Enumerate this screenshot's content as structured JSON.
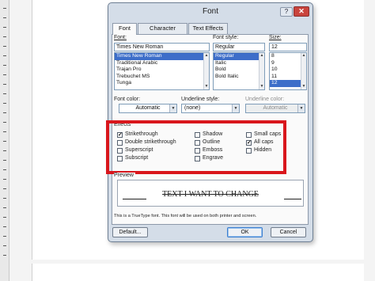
{
  "dialog": {
    "title": "Font",
    "help": "?",
    "close": "✕",
    "tabs": [
      "Font",
      "Character Spacing",
      "Text Effects"
    ]
  },
  "font_tab": {
    "font_label": "Font:",
    "font_value": "Times New Roman",
    "font_list": [
      "Times New Roman",
      "Traditional Arabic",
      "Trajan Pro",
      "Trebuchet MS",
      "Tunga"
    ],
    "font_selected": "Times New Roman",
    "style_label": "Font style:",
    "style_value": "Regular",
    "style_list": [
      "Regular",
      "Italic",
      "Bold",
      "Bold Italic"
    ],
    "style_selected": "Regular",
    "size_label": "Size:",
    "size_value": "12",
    "size_list": [
      "8",
      "9",
      "10",
      "11",
      "12"
    ],
    "size_selected": "12",
    "font_color_label": "Font color:",
    "font_color_value": "Automatic",
    "underline_style_label": "Underline style:",
    "underline_style_value": "(none)",
    "underline_color_label": "Underline color:",
    "underline_color_value": "Automatic"
  },
  "effects": {
    "label": "Effects",
    "items": [
      {
        "label": "Strikethrough",
        "checked": true
      },
      {
        "label": "Double strikethrough",
        "checked": false
      },
      {
        "label": "Superscript",
        "checked": false
      },
      {
        "label": "Subscript",
        "checked": false
      },
      {
        "label": "Shadow",
        "checked": false
      },
      {
        "label": "Outline",
        "checked": false
      },
      {
        "label": "Emboss",
        "checked": false
      },
      {
        "label": "Engrave",
        "checked": false
      },
      {
        "label": "Small caps",
        "checked": false
      },
      {
        "label": "All caps",
        "checked": true
      },
      {
        "label": "Hidden",
        "checked": false
      }
    ],
    "check_mark": "✓"
  },
  "preview": {
    "label": "Preview",
    "text": "TEXT I WANT TO CHANGE",
    "note": "This is a TrueType font. This font will be used on both printer and screen."
  },
  "buttons": {
    "default": "Default...",
    "ok": "OK",
    "cancel": "Cancel"
  },
  "colors": {
    "highlight": "#d9161c",
    "selection": "#3d6ec9"
  }
}
